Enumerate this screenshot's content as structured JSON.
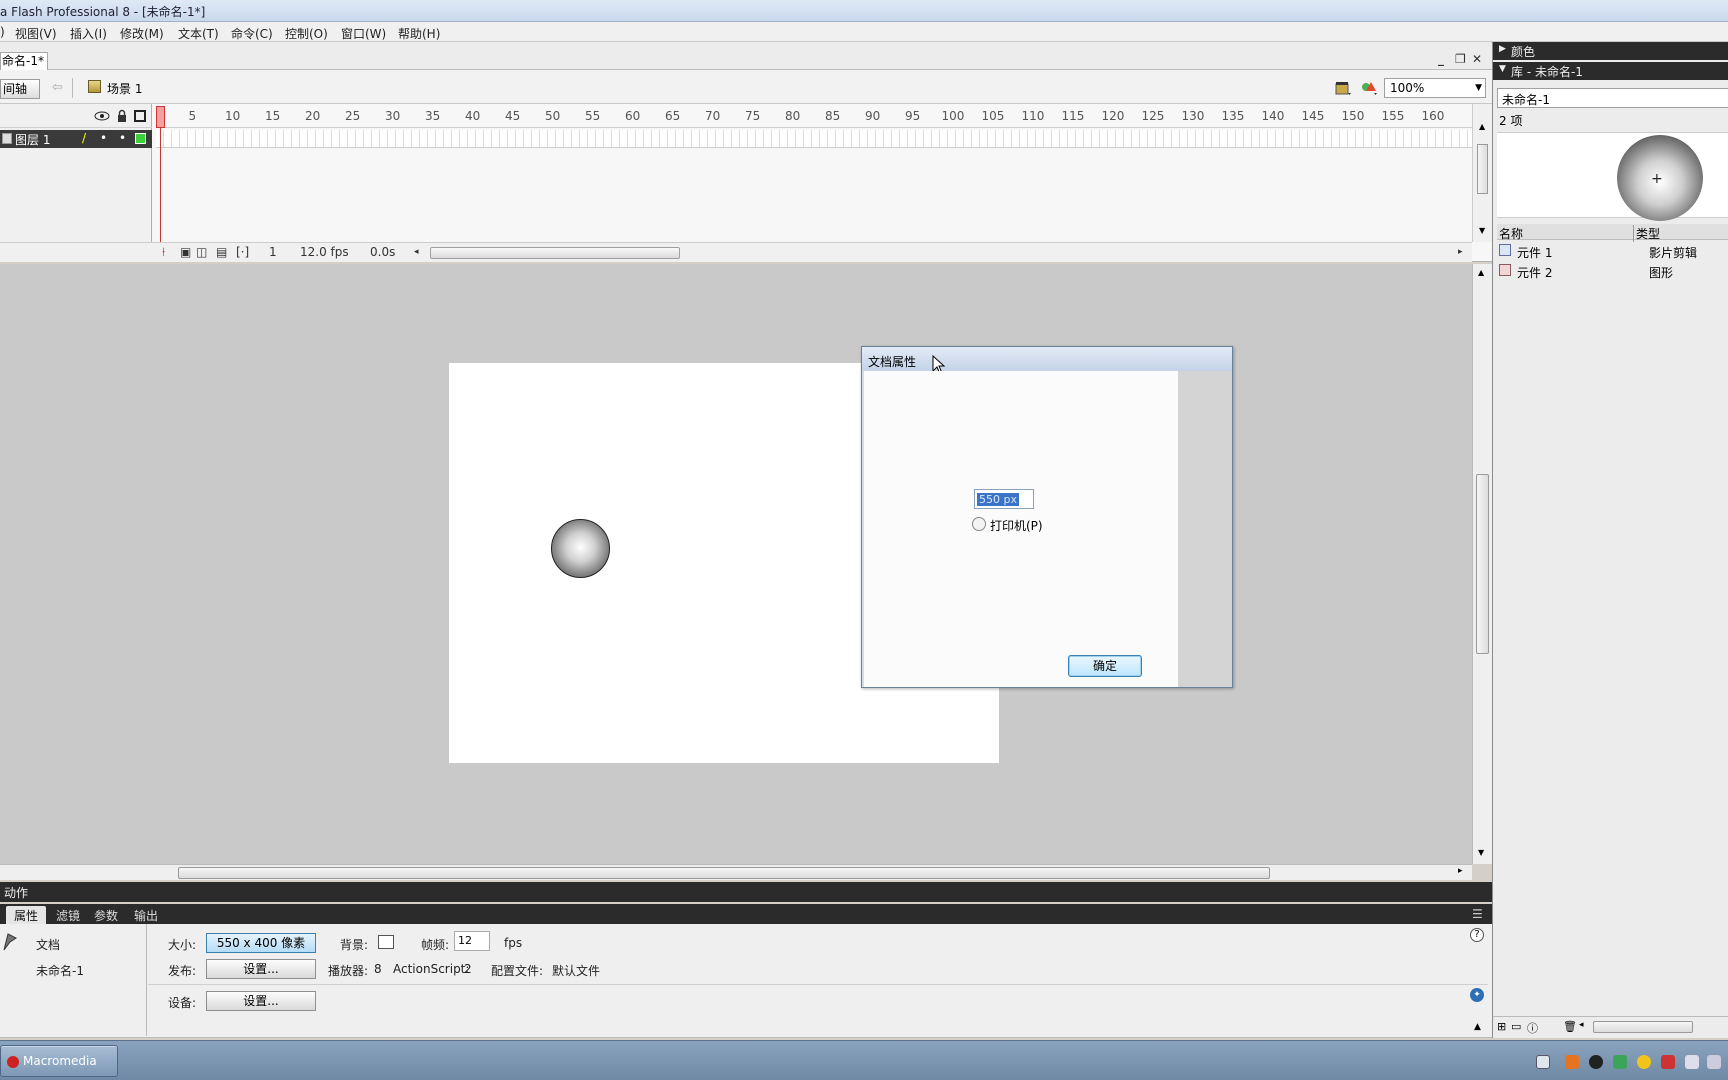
{
  "window": {
    "title": "a Flash Professional 8 - [未命名-1*]"
  },
  "menu": [
    "视图(V)",
    "插入(I)",
    "修改(M)",
    "文本(T)",
    "命令(C)",
    "控制(O)",
    "窗口(W)",
    "帮助(H)"
  ],
  "doc_tab": {
    "label": "命名-1*"
  },
  "window_controls": {
    "minimize": "_",
    "restore": "❐",
    "close": "✕"
  },
  "timeline_bar": {
    "toggle_label": "间轴",
    "scene_label": "场景 1",
    "zoom": "100%"
  },
  "timeline": {
    "layer_name": "图层 1",
    "ruler_numbers": [
      "5",
      "10",
      "15",
      "20",
      "25",
      "30",
      "35",
      "40",
      "45",
      "50",
      "55",
      "60",
      "65",
      "70",
      "75",
      "80",
      "85",
      "90",
      "95",
      "100",
      "105",
      "110",
      "115",
      "120",
      "125",
      "130",
      "135",
      "140",
      "145",
      "150",
      "155",
      "160"
    ],
    "current_frame": "1",
    "frame_rate": "12.0 fps",
    "elapsed": "0.0s"
  },
  "dialog": {
    "title": "文档属性",
    "width_value": "550 px",
    "printer_option": "打印机(P)",
    "ok_label": "确定"
  },
  "actions_panel": {
    "label": "动作"
  },
  "properties": {
    "tabs": [
      "属性",
      "滤镜",
      "参数",
      "输出"
    ],
    "doc_type": "文档",
    "doc_name": "未命名-1",
    "size_label": "大小:",
    "size_value": "550 x 400 像素",
    "bg_label": "背景:",
    "fps_label": "帧频:",
    "fps_value": "12",
    "fps_unit": "fps",
    "publish_label": "发布:",
    "settings_label": "设置...",
    "player_label": "播放器:",
    "player_value": "8",
    "as_label": "ActionScript:",
    "as_value": "2",
    "profile_label": "配置文件:",
    "profile_value": "默认文件",
    "device_label": "设备:",
    "device_settings": "设置..."
  },
  "right_panel": {
    "color_header": "颜色",
    "library_header": "库 - 未命名-1",
    "library_select": "未命名-1",
    "item_count": "2 项",
    "col_name": "名称",
    "col_type": "类型",
    "items": [
      {
        "name": "元件 1",
        "type": "影片剪辑"
      },
      {
        "name": "元件 2",
        "type": "图形"
      }
    ]
  },
  "taskbar": {
    "app_button": "Macromedia Fla..."
  },
  "colors": {
    "accent": "#3c7fb1",
    "stage_bg": "#c9c9c9",
    "panel_dark": "#2b2b2b"
  }
}
